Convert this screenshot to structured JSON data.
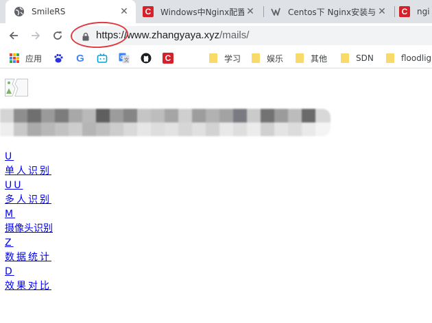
{
  "browser": {
    "tabs": [
      {
        "title": "SmileRS",
        "favicon": "globe-icon",
        "active": true
      },
      {
        "title": "Windows中Nginx配置",
        "favicon": "csdn-icon",
        "active": false
      },
      {
        "title": "Centos下 Nginx安装与",
        "favicon": "sns-icon",
        "active": false
      },
      {
        "title": "ngi",
        "favicon": "csdn-icon",
        "active": false
      }
    ],
    "url": {
      "scheme": "https://",
      "host": "www.zhangyaya.xyz",
      "path": "/mails/"
    },
    "bookmarks": [
      {
        "label": "应用",
        "icon": "apps-icon"
      },
      {
        "label": "",
        "icon": "baidu-icon"
      },
      {
        "label": "",
        "icon": "google-icon"
      },
      {
        "label": "",
        "icon": "bilibili-icon"
      },
      {
        "label": "",
        "icon": "translate-icon"
      },
      {
        "label": "",
        "icon": "github-icon"
      },
      {
        "label": "",
        "icon": "csdn-icon"
      },
      {
        "label": "学习",
        "icon": "folder-icon"
      },
      {
        "label": "娱乐",
        "icon": "folder-icon"
      },
      {
        "label": "其他",
        "icon": "folder-icon"
      },
      {
        "label": "SDN",
        "icon": "folder-icon"
      },
      {
        "label": "floodligh",
        "icon": "folder-icon"
      }
    ]
  },
  "page": {
    "menu": [
      {
        "label": "U"
      },
      {
        "label": "单人识别"
      },
      {
        "label": "UU"
      },
      {
        "label": "多人识别"
      },
      {
        "label": "M"
      },
      {
        "label": "摄像头识别"
      },
      {
        "label": "Z"
      },
      {
        "label": "数据统计"
      },
      {
        "label": "D"
      },
      {
        "label": "效果对比"
      }
    ]
  },
  "colors": {
    "tabstrip": "#dee1e6",
    "link": "#0000ee",
    "annotation": "#e0383e",
    "csdn": "#d6202a"
  }
}
